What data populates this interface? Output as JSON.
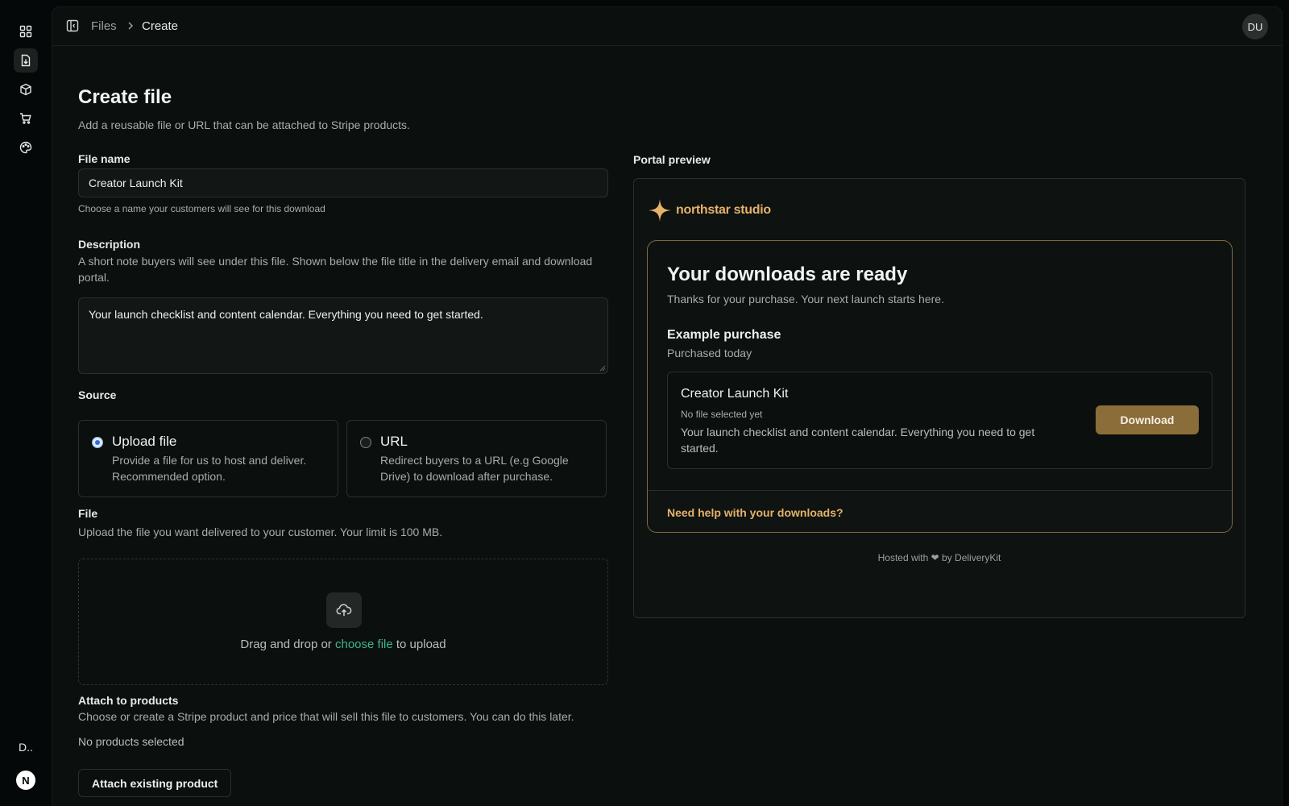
{
  "rail": {
    "items": [
      {
        "icon": "dashboard-grid-icon",
        "active": false
      },
      {
        "icon": "file-download-icon",
        "active": true
      },
      {
        "icon": "package-box-icon",
        "active": false
      },
      {
        "icon": "shopping-cart-icon",
        "active": false
      },
      {
        "icon": "palette-icon",
        "active": false
      }
    ],
    "workspace_abbrev": "D..",
    "user_initial": "N"
  },
  "header": {
    "breadcrumb": [
      "Files",
      "Create"
    ],
    "avatar_initials": "DU"
  },
  "form": {
    "title": "Create file",
    "subtitle": "Add a reusable file or URL that can be attached to Stripe products.",
    "file_name": {
      "label": "File name",
      "value": "Creator Launch Kit",
      "helper": "Choose a name your customers will see for this download"
    },
    "description": {
      "label": "Description",
      "helper": "A short note buyers will see under this file. Shown below the file title in the delivery email and download portal.",
      "value": "Your launch checklist and content calendar. Everything you need to get started."
    },
    "source": {
      "label": "Source",
      "options": [
        {
          "title": "Upload file",
          "description": "Provide a file for us to host and deliver. Recommended option.",
          "selected": true
        },
        {
          "title": "URL",
          "description": "Redirect buyers to a URL (e.g Google Drive) to download after purchase.",
          "selected": false
        }
      ]
    },
    "file": {
      "label": "File",
      "helper": "Upload the file you want delivered to your customer. Your limit is 100 MB.",
      "drop_prefix": "Drag and drop or ",
      "drop_link": "choose file",
      "drop_suffix": " to upload"
    },
    "attach": {
      "label": "Attach to products",
      "helper": "Choose or create a Stripe product and price that will sell this file to customers. You can do this later.",
      "status": "No products selected",
      "button": "Attach existing product"
    }
  },
  "preview": {
    "label": "Portal preview",
    "brand_name": "northstar studio",
    "title": "Your downloads are ready",
    "subtitle": "Thanks for your purchase. Your next launch starts here.",
    "purchase_title": "Example purchase",
    "purchase_date": "Purchased today",
    "item": {
      "name": "Creator Launch Kit",
      "status": "No file selected yet",
      "description": "Your launch checklist and content calendar. Everything you need to get started.",
      "button": "Download"
    },
    "help_link": "Need help with your downloads?",
    "hosted": "Hosted with ❤ by DeliveryKit"
  },
  "colors": {
    "accent_gold": "#e4b26a",
    "download_button": "#8b6d39",
    "link_green": "#3fb68b",
    "background": "#0b0f0e"
  }
}
